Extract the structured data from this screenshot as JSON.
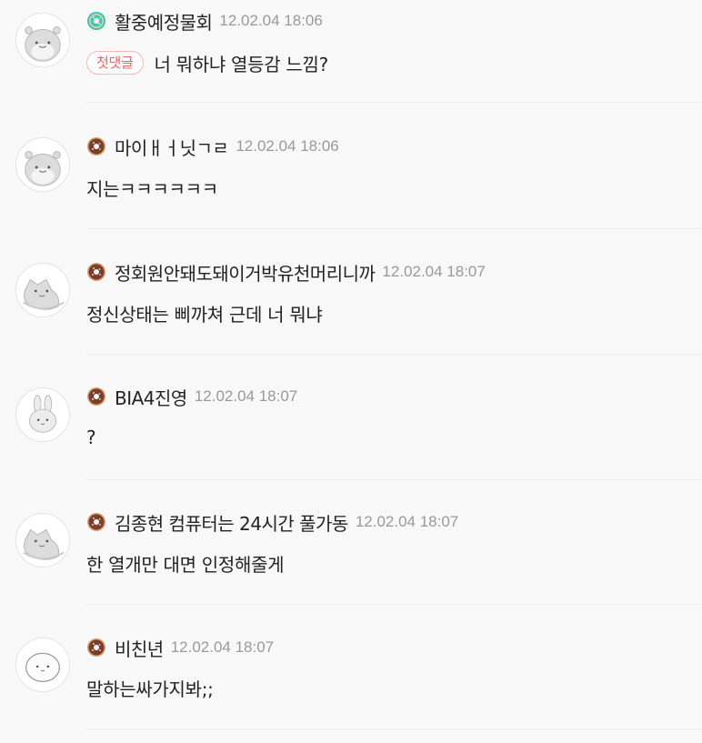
{
  "comments": [
    {
      "nickname": "활중예정물회",
      "date": "12.02.04 18:06",
      "first_tag": "첫댓글",
      "text": "너 뭐하냐 열등감 느낌?",
      "badge": "mint-donut-icon",
      "avatar": "hamster-avatar-icon"
    },
    {
      "nickname": "마이ㅐㅓ닛ㄱㄹ",
      "date": "12.02.04 18:06",
      "text": "지는ㅋㅋㅋㅋㅋㅋ",
      "badge": "choco-donut-icon",
      "avatar": "hamster-avatar-icon"
    },
    {
      "nickname": "정회원안돼도돼이거박유천머리니까",
      "date": "12.02.04 18:07",
      "text": "정신상태는 삐까쳐 근데 너 뭐냐",
      "badge": "choco-donut-icon",
      "avatar": "sleeping-cat-avatar-icon"
    },
    {
      "nickname": "BIA4진영",
      "date": "12.02.04 18:07",
      "text": "?",
      "badge": "choco-donut-icon",
      "avatar": "bunny-avatar-icon"
    },
    {
      "nickname": "김종현 컴퓨터는 24시간 풀가동",
      "date": "12.02.04 18:07",
      "text": "한 열개만 대면 인정해줄게",
      "badge": "choco-donut-icon",
      "avatar": "sleeping-cat-avatar-icon"
    },
    {
      "nickname": "비친년",
      "date": "12.02.04 18:07",
      "text": "말하는싸가지봐;;",
      "badge": "choco-donut-icon",
      "avatar": "blob-avatar-icon"
    }
  ],
  "colors": {
    "background": "#f8f8f8",
    "date": "#999999",
    "first_tag": "#ff5c5c",
    "mint_badge": "#35c5b8",
    "choco_badge": "#7a3f2c"
  }
}
